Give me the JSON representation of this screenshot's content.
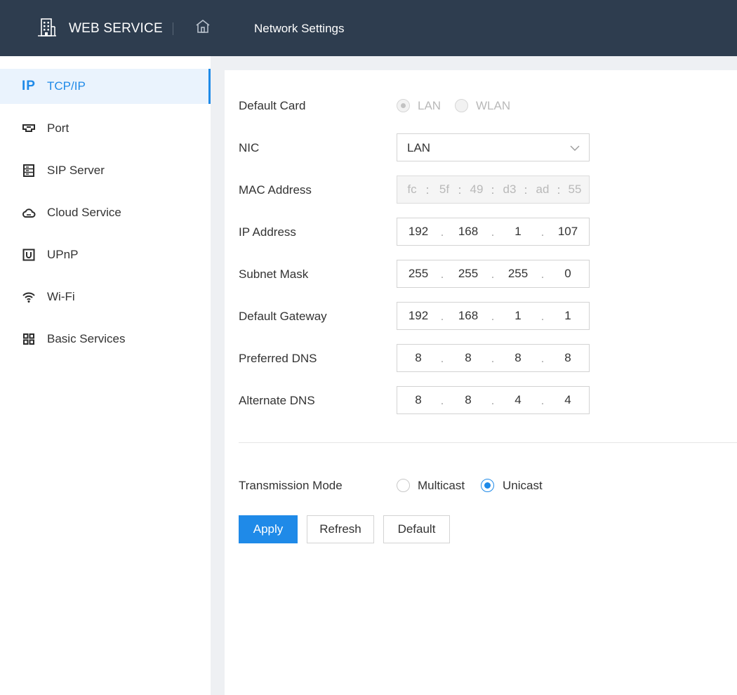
{
  "header": {
    "brand": "WEB SERVICE",
    "brand_icon": "building-icon",
    "home_icon": "home-icon",
    "page_title": "Network Settings"
  },
  "colors": {
    "header_bg": "#2e3d4f",
    "accent": "#1f8ae8"
  },
  "sidebar": {
    "items": [
      {
        "label": "TCP/IP",
        "icon": "ip-icon",
        "active": true
      },
      {
        "label": "Port",
        "icon": "port-icon"
      },
      {
        "label": "SIP Server",
        "icon": "server-icon"
      },
      {
        "label": "Cloud Service",
        "icon": "cloud-icon"
      },
      {
        "label": "UPnP",
        "icon": "upnp-icon"
      },
      {
        "label": "Wi-Fi",
        "icon": "wifi-icon"
      },
      {
        "label": "Basic Services",
        "icon": "grid-icon"
      }
    ]
  },
  "form": {
    "default_card": {
      "label": "Default Card",
      "options": [
        "LAN",
        "WLAN"
      ],
      "selected": "LAN",
      "disabled": true
    },
    "nic": {
      "label": "NIC",
      "value": "LAN"
    },
    "mac": {
      "label": "MAC Address",
      "segments": [
        "fc",
        "5f",
        "49",
        "d3",
        "ad",
        "55"
      ],
      "separator": ":"
    },
    "ip_address": {
      "label": "IP Address",
      "octets": [
        "192",
        "168",
        "1",
        "107"
      ]
    },
    "subnet_mask": {
      "label": "Subnet Mask",
      "octets": [
        "255",
        "255",
        "255",
        "0"
      ]
    },
    "default_gateway": {
      "label": "Default Gateway",
      "octets": [
        "192",
        "168",
        "1",
        "1"
      ]
    },
    "preferred_dns": {
      "label": "Preferred DNS",
      "octets": [
        "8",
        "8",
        "8",
        "8"
      ]
    },
    "alternate_dns": {
      "label": "Alternate DNS",
      "octets": [
        "8",
        "8",
        "4",
        "4"
      ]
    },
    "ip_separator": ".",
    "transmission_mode": {
      "label": "Transmission Mode",
      "options": [
        "Multicast",
        "Unicast"
      ],
      "selected": "Unicast"
    }
  },
  "buttons": {
    "apply": "Apply",
    "refresh": "Refresh",
    "default": "Default"
  }
}
